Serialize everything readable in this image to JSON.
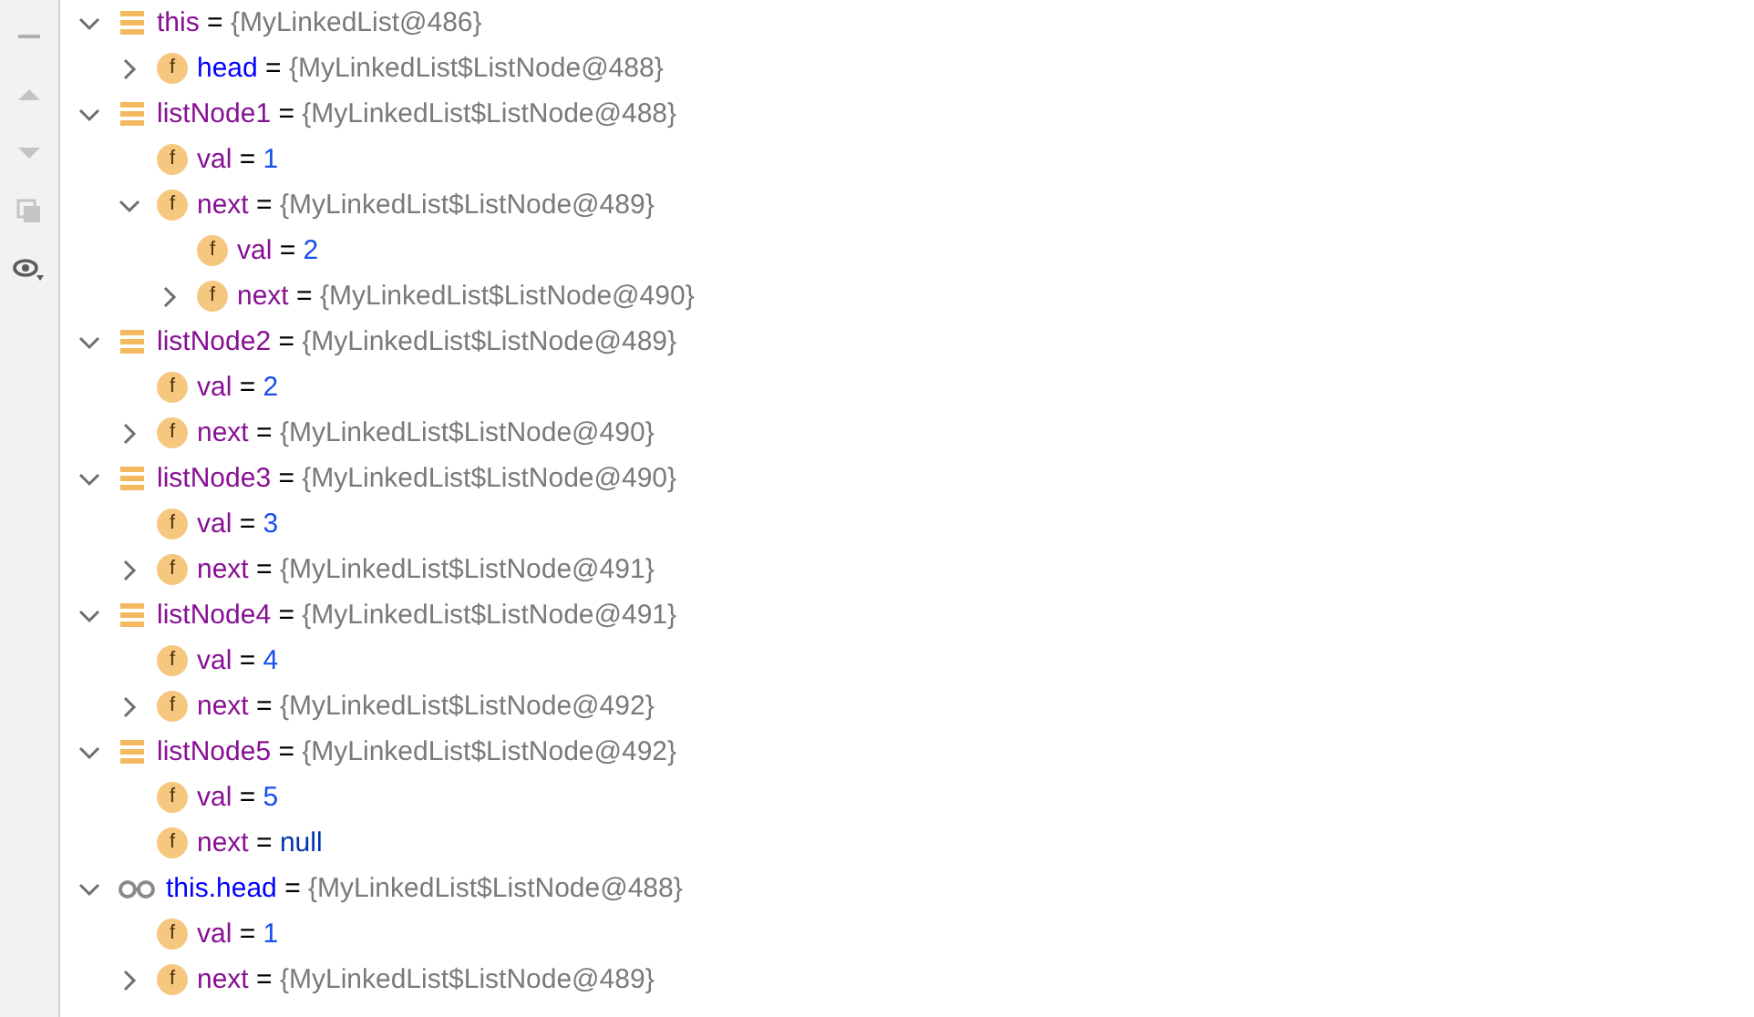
{
  "variables": [
    {
      "kind": "local",
      "name": {
        "text": "this",
        "color": "#871094"
      },
      "separator": "=",
      "value": {
        "text": "{MyLinkedList@486}",
        "color": "#7a7a7a"
      },
      "expanded": true,
      "children": [
        {
          "kind": "field",
          "icon_label": "f",
          "name": {
            "text": "head",
            "color": "#0000ff"
          },
          "separator": "=",
          "value": {
            "text": "{MyLinkedList$ListNode@488}",
            "color": "#7a7a7a"
          },
          "expanded": false
        }
      ]
    },
    {
      "kind": "local",
      "name": {
        "text": "listNode1",
        "color": "#871094"
      },
      "separator": "=",
      "value": {
        "text": "{MyLinkedList$ListNode@488}",
        "color": "#7a7a7a"
      },
      "expanded": true,
      "children": [
        {
          "kind": "field",
          "icon_label": "f",
          "name": {
            "text": "val",
            "color": "#871094"
          },
          "separator": "=",
          "value": {
            "text": "1",
            "color": "#1750eb"
          }
        },
        {
          "kind": "field",
          "icon_label": "f",
          "name": {
            "text": "next",
            "color": "#871094"
          },
          "separator": "=",
          "value": {
            "text": "{MyLinkedList$ListNode@489}",
            "color": "#7a7a7a"
          },
          "expanded": true,
          "children": [
            {
              "kind": "field",
              "icon_label": "f",
              "name": {
                "text": "val",
                "color": "#871094"
              },
              "separator": "=",
              "value": {
                "text": "2",
                "color": "#1750eb"
              }
            },
            {
              "kind": "field",
              "icon_label": "f",
              "name": {
                "text": "next",
                "color": "#871094"
              },
              "separator": "=",
              "value": {
                "text": "{MyLinkedList$ListNode@490}",
                "color": "#7a7a7a"
              },
              "expanded": false
            }
          ]
        }
      ]
    },
    {
      "kind": "local",
      "name": {
        "text": "listNode2",
        "color": "#871094"
      },
      "separator": "=",
      "value": {
        "text": "{MyLinkedList$ListNode@489}",
        "color": "#7a7a7a"
      },
      "expanded": true,
      "children": [
        {
          "kind": "field",
          "icon_label": "f",
          "name": {
            "text": "val",
            "color": "#871094"
          },
          "separator": "=",
          "value": {
            "text": "2",
            "color": "#1750eb"
          }
        },
        {
          "kind": "field",
          "icon_label": "f",
          "name": {
            "text": "next",
            "color": "#871094"
          },
          "separator": "=",
          "value": {
            "text": "{MyLinkedList$ListNode@490}",
            "color": "#7a7a7a"
          },
          "expanded": false
        }
      ]
    },
    {
      "kind": "local",
      "name": {
        "text": "listNode3",
        "color": "#871094"
      },
      "separator": "=",
      "value": {
        "text": "{MyLinkedList$ListNode@490}",
        "color": "#7a7a7a"
      },
      "expanded": true,
      "children": [
        {
          "kind": "field",
          "icon_label": "f",
          "name": {
            "text": "val",
            "color": "#871094"
          },
          "separator": "=",
          "value": {
            "text": "3",
            "color": "#1750eb"
          }
        },
        {
          "kind": "field",
          "icon_label": "f",
          "name": {
            "text": "next",
            "color": "#871094"
          },
          "separator": "=",
          "value": {
            "text": "{MyLinkedList$ListNode@491}",
            "color": "#7a7a7a"
          },
          "expanded": false
        }
      ]
    },
    {
      "kind": "local",
      "name": {
        "text": "listNode4",
        "color": "#871094"
      },
      "separator": "=",
      "value": {
        "text": "{MyLinkedList$ListNode@491}",
        "color": "#7a7a7a"
      },
      "expanded": true,
      "children": [
        {
          "kind": "field",
          "icon_label": "f",
          "name": {
            "text": "val",
            "color": "#871094"
          },
          "separator": "=",
          "value": {
            "text": "4",
            "color": "#1750eb"
          }
        },
        {
          "kind": "field",
          "icon_label": "f",
          "name": {
            "text": "next",
            "color": "#871094"
          },
          "separator": "=",
          "value": {
            "text": "{MyLinkedList$ListNode@492}",
            "color": "#7a7a7a"
          },
          "expanded": false
        }
      ]
    },
    {
      "kind": "local",
      "name": {
        "text": "listNode5",
        "color": "#871094"
      },
      "separator": "=",
      "value": {
        "text": "{MyLinkedList$ListNode@492}",
        "color": "#7a7a7a"
      },
      "expanded": true,
      "children": [
        {
          "kind": "field",
          "icon_label": "f",
          "name": {
            "text": "val",
            "color": "#871094"
          },
          "separator": "=",
          "value": {
            "text": "5",
            "color": "#1750eb"
          }
        },
        {
          "kind": "field",
          "icon_label": "f",
          "name": {
            "text": "next",
            "color": "#871094"
          },
          "separator": "=",
          "value": {
            "text": "null",
            "color": "#0033b3"
          }
        }
      ]
    },
    {
      "kind": "watch",
      "name": {
        "text": "this.head",
        "color": "#0000ff"
      },
      "separator": "=",
      "value": {
        "text": "{MyLinkedList$ListNode@488}",
        "color": "#7a7a7a"
      },
      "expanded": true,
      "children": [
        {
          "kind": "field",
          "icon_label": "f",
          "name": {
            "text": "val",
            "color": "#871094"
          },
          "separator": "=",
          "value": {
            "text": "1",
            "color": "#1750eb"
          }
        },
        {
          "kind": "field",
          "icon_label": "f",
          "name": {
            "text": "next",
            "color": "#871094"
          },
          "separator": "=",
          "value": {
            "text": "{MyLinkedList$ListNode@489}",
            "color": "#7a7a7a"
          },
          "expanded": false
        }
      ]
    }
  ]
}
